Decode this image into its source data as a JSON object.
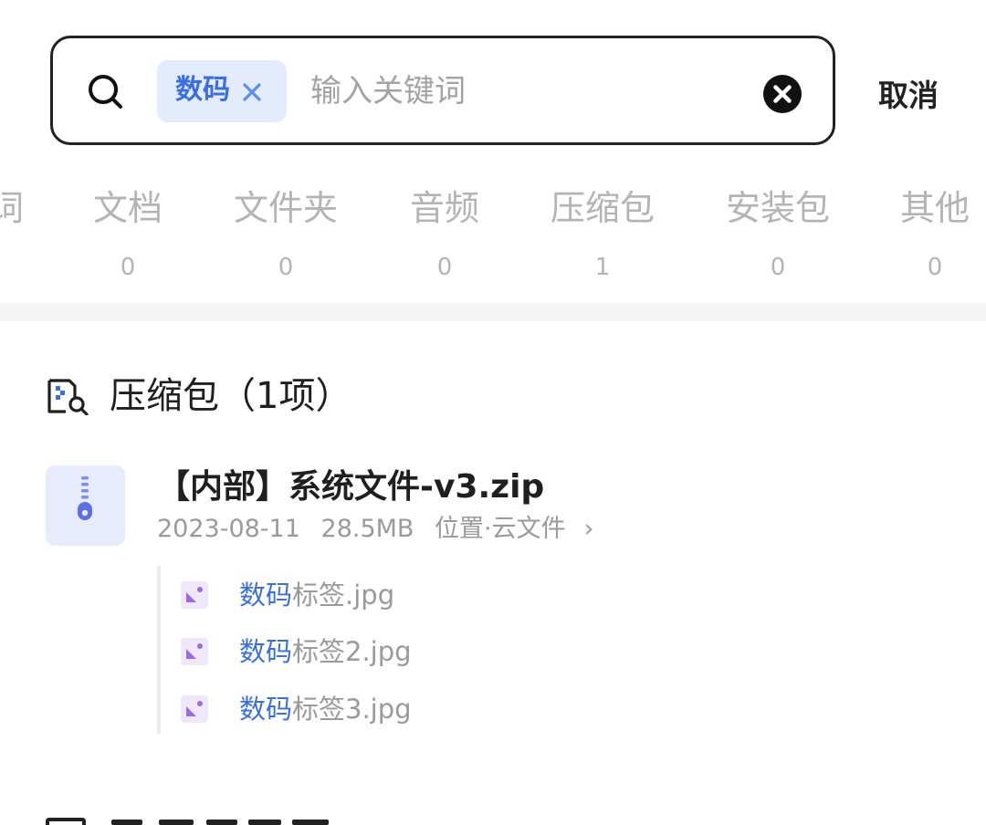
{
  "search": {
    "tag_label": "数码",
    "input_value": "",
    "placeholder": "输入关键词",
    "cancel_label": "取消"
  },
  "categories": {
    "partial_label": "词",
    "items": [
      {
        "label": "文档",
        "count": "0"
      },
      {
        "label": "文件夹",
        "count": "0"
      },
      {
        "label": "音频",
        "count": "0"
      },
      {
        "label": "压缩包",
        "count": "1"
      },
      {
        "label": "安装包",
        "count": "0"
      },
      {
        "label": "其他",
        "count": "0"
      }
    ]
  },
  "section": {
    "title": "压缩包（1项）",
    "icon": "archive-search-icon"
  },
  "file": {
    "name": "【内部】系统文件-v3.zip",
    "date": "2023-08-11",
    "size": "28.5MB",
    "location": "位置·云文件",
    "location_chevron": "›",
    "icon": "zip-file-icon",
    "contents": [
      {
        "highlight": "数码",
        "rest": "标签.jpg",
        "icon": "image-file-icon"
      },
      {
        "highlight": "数码",
        "rest": "标签2.jpg",
        "icon": "image-file-icon"
      },
      {
        "highlight": "数码",
        "rest": "标签3.jpg",
        "icon": "image-file-icon"
      }
    ]
  },
  "colors": {
    "accent": "#3a6fe0",
    "chip_bg": "#e3ebfc",
    "muted_text": "#9a9a9a",
    "tab_text": "#b4b4b4",
    "image_icon": "#9b6be0"
  }
}
